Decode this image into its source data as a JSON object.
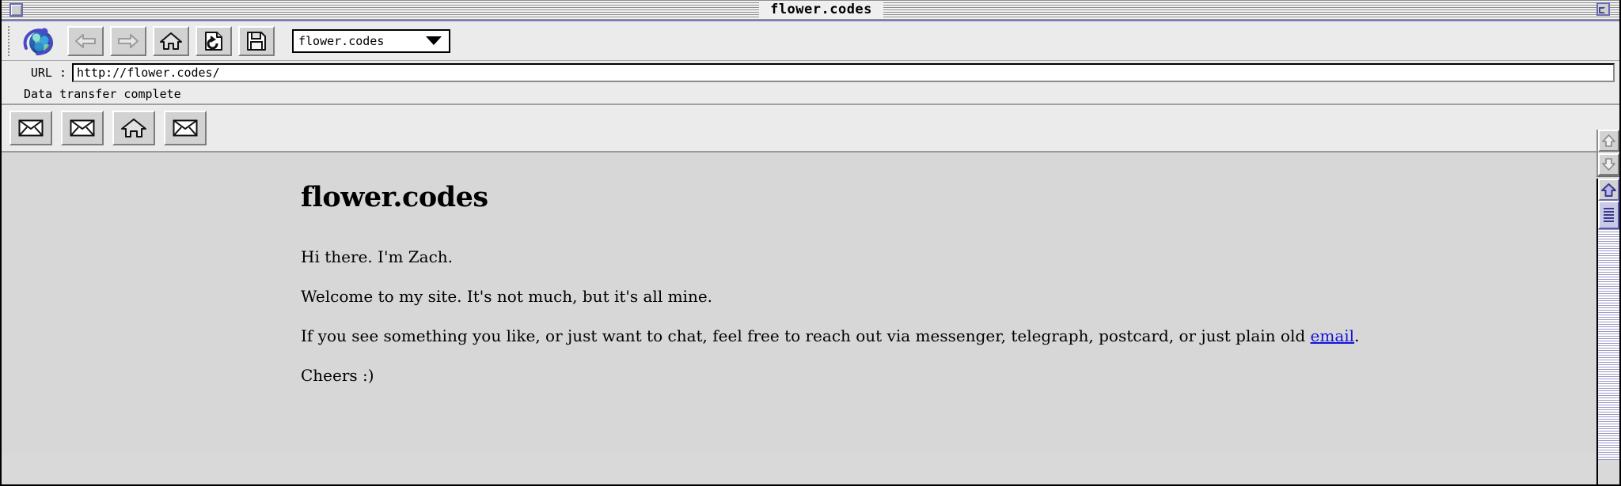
{
  "window": {
    "title": "flower.codes",
    "close_button": "close",
    "zoom_button": "zoom"
  },
  "toolbar": {
    "spinner_icon": "globe-spinner-icon",
    "buttons": [
      {
        "name": "back",
        "icon": "arrow-left-icon",
        "enabled": false
      },
      {
        "name": "forward",
        "icon": "arrow-right-icon",
        "enabled": false
      },
      {
        "name": "home",
        "icon": "home-icon",
        "enabled": true
      },
      {
        "name": "reload",
        "icon": "reload-page-icon",
        "enabled": true
      },
      {
        "name": "save",
        "icon": "floppy-disk-icon",
        "enabled": true
      }
    ],
    "dropdown": {
      "value": "flower.codes",
      "caret_icon": "chevron-down-icon",
      "options": [
        "flower.codes"
      ]
    }
  },
  "url_bar": {
    "label": "URL :",
    "value": "http://flower.codes/",
    "placeholder": "http://"
  },
  "status": {
    "text": "Data transfer complete"
  },
  "linkbar": {
    "buttons": [
      {
        "name": "mail-1",
        "icon": "envelope-icon"
      },
      {
        "name": "mail-2",
        "icon": "envelope-icon"
      },
      {
        "name": "home-link",
        "icon": "home-icon"
      },
      {
        "name": "mail-3",
        "icon": "envelope-icon"
      }
    ]
  },
  "page": {
    "heading": "flower.codes",
    "paragraphs": [
      "Hi there. I'm Zach.",
      "Welcome to my site. It's not much, but it's all mine."
    ],
    "contact": {
      "before": "If you see something you like, or just want to chat, feel free to reach out via messenger, telegraph, postcard, or just plain old ",
      "link_text": "email",
      "after": "."
    },
    "sign_off": "Cheers :)"
  },
  "scrollbars": {
    "toolbar": {
      "up_icon": "scroll-up-arrow-icon",
      "down_icon": "scroll-down-arrow-icon",
      "enabled": false
    },
    "content": {
      "up_icon": "scroll-up-arrow-icon",
      "thumb": "scroll-thumb",
      "enabled": true
    }
  },
  "colors": {
    "accent": "#6b6bb5",
    "link": "#1414dd",
    "page_background": "#d7d7d7",
    "chrome_background": "#ebebeb"
  }
}
